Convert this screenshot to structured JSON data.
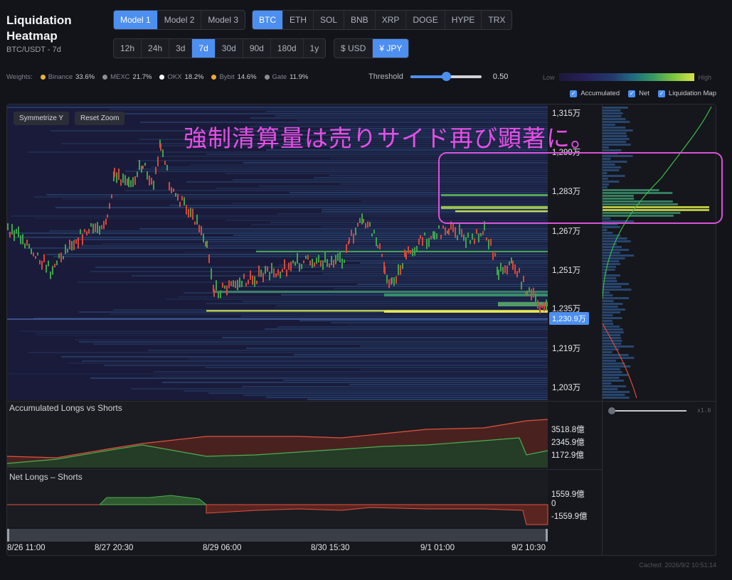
{
  "header": {
    "title": "Liquidation Heatmap",
    "subtitle": "BTC/USDT - 7d"
  },
  "models": [
    {
      "label": "Model 1",
      "active": true
    },
    {
      "label": "Model 2",
      "active": false
    },
    {
      "label": "Model 3",
      "active": false
    }
  ],
  "coins": [
    {
      "label": "BTC",
      "active": true
    },
    {
      "label": "ETH",
      "active": false
    },
    {
      "label": "SOL",
      "active": false
    },
    {
      "label": "BNB",
      "active": false
    },
    {
      "label": "XRP",
      "active": false
    },
    {
      "label": "DOGE",
      "active": false
    },
    {
      "label": "HYPE",
      "active": false
    },
    {
      "label": "TRX",
      "active": false
    }
  ],
  "ranges": [
    {
      "label": "12h",
      "active": false
    },
    {
      "label": "24h",
      "active": false
    },
    {
      "label": "3d",
      "active": false
    },
    {
      "label": "7d",
      "active": true
    },
    {
      "label": "30d",
      "active": false
    },
    {
      "label": "90d",
      "active": false
    },
    {
      "label": "180d",
      "active": false
    },
    {
      "label": "1y",
      "active": false
    }
  ],
  "currencies": [
    {
      "label": "$ USD",
      "active": false
    },
    {
      "label": "¥ JPY",
      "active": true
    }
  ],
  "weights": {
    "label": "Weights:",
    "items": [
      {
        "name": "Binance",
        "pct": "33.6%",
        "color": "#e8b33b"
      },
      {
        "name": "MEXC",
        "pct": "21.7%",
        "color": "#8a8f98"
      },
      {
        "name": "OKX",
        "pct": "18.2%",
        "color": "#ffffff"
      },
      {
        "name": "Bybit",
        "pct": "14.6%",
        "color": "#f0a83a"
      },
      {
        "name": "Gate",
        "pct": "11.9%",
        "color": "#8a8f98"
      }
    ]
  },
  "threshold": {
    "label": "Threshold",
    "value": "0.50",
    "fraction": 0.5
  },
  "legend": {
    "low": "Low",
    "high": "High"
  },
  "toggles": [
    {
      "label": "Accumulated",
      "checked": true
    },
    {
      "label": "Net",
      "checked": true
    },
    {
      "label": "Liquidation Map",
      "checked": true
    }
  ],
  "heatmap": {
    "buttons": {
      "symmetrize": "Symmetrize Y",
      "reset": "Reset Zoom"
    },
    "annotation": "強制清算量は売りサイド再び顕著に。",
    "current_price": "1,230.9万",
    "y_labels": [
      "1,315万",
      "1,299万",
      "1,283万",
      "1,267万",
      "1,251万",
      "1,235万",
      "1,219万",
      "1,203万"
    ]
  },
  "accumulated": {
    "title": "Accumulated Longs vs Shorts",
    "labels": [
      "3518.8億",
      "2345.9億",
      "1172.9億"
    ]
  },
  "net": {
    "title": "Net Longs – Shorts",
    "labels": [
      "1559.9億",
      "0",
      "-1559.9億"
    ]
  },
  "side_slider": {
    "value": "x1.0"
  },
  "x_labels": [
    "8/26 11:00",
    "8/27 20:30",
    "8/29 06:00",
    "8/30 15:30",
    "9/1 01:00",
    "9/2 10:30"
  ],
  "cached": "Cached: 2026/9/2 10:51:14",
  "colors": {
    "accent": "#4d8ff0",
    "annotation": "#e64fe6",
    "long": "#3a8f3a",
    "short": "#c0392b"
  }
}
